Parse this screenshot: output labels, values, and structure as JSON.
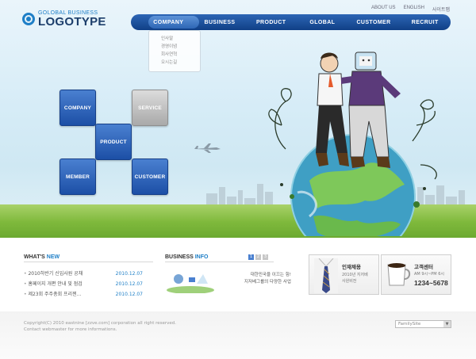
{
  "logo": {
    "small": "GOLOBAL BUSINESS",
    "big": "LOGOTYPE"
  },
  "util_links": [
    "ABOUT US",
    "ENGLISH",
    "사이트맵"
  ],
  "nav": [
    "COMPANY",
    "BUSINESS",
    "PRODUCT",
    "GLOBAL",
    "CUSTOMER",
    "RECRUIT"
  ],
  "dropdown": [
    "인사말",
    "경영이념",
    "회사연혁",
    "오시는길"
  ],
  "tiles": {
    "company": "COMPANY",
    "service": "SERVICE",
    "product": "PRODUCT",
    "member": "MEMBER",
    "customer": "CUSTOMER"
  },
  "news": {
    "title_a": "WHAT'S ",
    "title_b": "NEW",
    "items": [
      {
        "title": "2010하반기 신입사원 공채",
        "date": "2010.12.07"
      },
      {
        "title": "홈페이지 개편 안내 및 점검",
        "date": "2010.12.07"
      },
      {
        "title": "제23회 주주총회 프리젠...",
        "date": "2010.12.07"
      }
    ]
  },
  "business": {
    "title_a": "BUSINESS ",
    "title_b": "INFO",
    "text1": "대한민국을 이끄는 힘!",
    "text2": "지저베그룹의 다양한 사업",
    "arrows": [
      "1",
      "2",
      "3"
    ]
  },
  "recruit": {
    "title": "인재채용",
    "sub1": "2010년 지저베",
    "sub2": "사원비전"
  },
  "center": {
    "title": "고객센터",
    "hours": "AM 9시~PM 6시",
    "phone": "1234~5678"
  },
  "footer": {
    "line1": "Copyright(C) 2010 eastnine [zzve.com] corporation all right reserved.",
    "line2": "Contact webmaster for more informations."
  },
  "family_site": "FamilySite"
}
